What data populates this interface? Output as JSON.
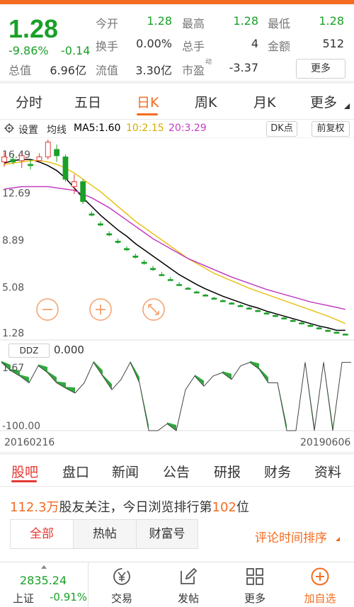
{
  "quote": {
    "price": "1.28",
    "change_pct": "-9.86%",
    "change_abs": "-0.14",
    "fields": [
      {
        "label": "今开",
        "value": "1.28"
      },
      {
        "label": "最高",
        "value": "1.28"
      },
      {
        "label": "最低",
        "value": "1.28"
      },
      {
        "label": "换手",
        "value": "0.00%"
      },
      {
        "label": "总手",
        "value": "4"
      },
      {
        "label": "金额",
        "value": "512"
      },
      {
        "label": "总值",
        "value": "6.96亿"
      },
      {
        "label": "流值",
        "value": "3.30亿"
      },
      {
        "label": "市盈",
        "value": "-3.37"
      }
    ],
    "pe_sup": "动",
    "more_label": "更多"
  },
  "period_tabs": [
    "分时",
    "五日",
    "日K",
    "周K",
    "月K",
    "更多"
  ],
  "active_period": "日K",
  "ma_bar": {
    "settings": "设置",
    "ma_title": "均线",
    "ma5": "MA5:1.60",
    "ma10": "10:2.15",
    "ma20": "20:3.29",
    "dk_label": "DK点",
    "adjust_label": "前复权"
  },
  "colors": {
    "accent": "#f36c21",
    "up": "#e53935",
    "down": "#1aa028",
    "ma5": "#000000",
    "ma10": "#e8c21a",
    "ma20": "#c23ec2"
  },
  "chart_data": [
    {
      "type": "candlestick",
      "title": "",
      "y_ticks": [
        "16.49",
        "12.69",
        "8.89",
        "5.08",
        "1.28"
      ],
      "ylim": [
        1.28,
        16.49
      ],
      "x_start_label": "20160216",
      "x_end_label": "20190606",
      "candles": [
        {
          "o": 15.2,
          "h": 16.0,
          "l": 14.8,
          "c": 15.6
        },
        {
          "o": 15.4,
          "h": 15.8,
          "l": 15.0,
          "c": 15.2
        },
        {
          "o": 15.3,
          "h": 16.0,
          "l": 14.7,
          "c": 15.7
        },
        {
          "o": 15.0,
          "h": 15.4,
          "l": 14.6,
          "c": 14.9
        },
        {
          "o": 15.3,
          "h": 15.9,
          "l": 15.1,
          "c": 15.6
        },
        {
          "o": 15.6,
          "h": 17.0,
          "l": 15.4,
          "c": 16.8
        },
        {
          "o": 16.2,
          "h": 16.6,
          "l": 15.2,
          "c": 15.7
        },
        {
          "o": 15.6,
          "h": 15.8,
          "l": 13.6,
          "c": 13.8
        },
        {
          "o": 13.2,
          "h": 14.2,
          "l": 12.6,
          "c": 13.6
        },
        {
          "o": 13.6,
          "h": 13.8,
          "l": 11.8,
          "c": 12.0
        },
        {
          "o": 11.0,
          "h": 11.2,
          "l": 10.8,
          "c": 10.9
        },
        {
          "o": 10.2,
          "h": 10.4,
          "l": 10.0,
          "c": 10.1
        },
        {
          "o": 9.4,
          "h": 9.6,
          "l": 9.2,
          "c": 9.3
        },
        {
          "o": 8.8,
          "h": 9.0,
          "l": 8.6,
          "c": 8.7
        },
        {
          "o": 8.2,
          "h": 8.4,
          "l": 8.0,
          "c": 8.1
        },
        {
          "o": 7.6,
          "h": 7.8,
          "l": 7.4,
          "c": 7.5
        },
        {
          "o": 7.1,
          "h": 7.3,
          "l": 6.9,
          "c": 7.0
        },
        {
          "o": 6.6,
          "h": 6.8,
          "l": 6.4,
          "c": 6.5
        },
        {
          "o": 6.1,
          "h": 6.3,
          "l": 6.0,
          "c": 6.05
        },
        {
          "o": 5.7,
          "h": 5.9,
          "l": 5.6,
          "c": 5.65
        },
        {
          "o": 5.3,
          "h": 5.5,
          "l": 5.2,
          "c": 5.25
        },
        {
          "o": 5.0,
          "h": 5.1,
          "l": 4.9,
          "c": 4.95
        },
        {
          "o": 4.7,
          "h": 4.8,
          "l": 4.6,
          "c": 4.65
        },
        {
          "o": 4.45,
          "h": 4.55,
          "l": 4.35,
          "c": 4.4
        },
        {
          "o": 4.2,
          "h": 4.3,
          "l": 4.1,
          "c": 4.15
        },
        {
          "o": 4.0,
          "h": 4.1,
          "l": 3.9,
          "c": 3.95
        },
        {
          "o": 3.8,
          "h": 3.9,
          "l": 3.7,
          "c": 3.75
        },
        {
          "o": 3.6,
          "h": 3.7,
          "l": 3.5,
          "c": 3.55
        },
        {
          "o": 3.4,
          "h": 3.5,
          "l": 3.3,
          "c": 3.35
        },
        {
          "o": 3.2,
          "h": 3.3,
          "l": 3.1,
          "c": 3.15
        },
        {
          "o": 3.0,
          "h": 3.1,
          "l": 2.9,
          "c": 2.95
        },
        {
          "o": 2.8,
          "h": 2.9,
          "l": 2.7,
          "c": 2.75
        },
        {
          "o": 2.6,
          "h": 2.7,
          "l": 2.5,
          "c": 2.55
        },
        {
          "o": 2.4,
          "h": 2.5,
          "l": 2.3,
          "c": 2.35
        },
        {
          "o": 2.2,
          "h": 2.3,
          "l": 2.1,
          "c": 2.15
        },
        {
          "o": 2.0,
          "h": 2.1,
          "l": 1.9,
          "c": 1.95
        },
        {
          "o": 1.8,
          "h": 1.9,
          "l": 1.7,
          "c": 1.75
        },
        {
          "o": 1.6,
          "h": 1.7,
          "l": 1.5,
          "c": 1.55
        },
        {
          "o": 1.45,
          "h": 1.5,
          "l": 1.4,
          "c": 1.42
        },
        {
          "o": 1.3,
          "h": 1.35,
          "l": 1.28,
          "c": 1.28
        }
      ],
      "series": [
        {
          "name": "MA5",
          "values": [
            15.1,
            15.3,
            15.4,
            15.4,
            15.2,
            14.9,
            14.5,
            13.9,
            13.1,
            12.3,
            11.6,
            10.9,
            10.3,
            9.7,
            9.2,
            8.6,
            8.1,
            7.6,
            7.1,
            6.6,
            6.1,
            5.7,
            5.3,
            4.95,
            4.65,
            4.35,
            4.1,
            3.85,
            3.6,
            3.4,
            3.15,
            2.95,
            2.75,
            2.55,
            2.35,
            2.15,
            1.95,
            1.8,
            1.6,
            1.6
          ]
        },
        {
          "name": "MA10",
          "values": [
            15.0,
            15.1,
            15.2,
            15.3,
            15.3,
            15.2,
            15.0,
            14.7,
            14.3,
            13.8,
            13.3,
            12.8,
            12.2,
            11.6,
            11.0,
            10.4,
            9.9,
            9.4,
            8.9,
            8.4,
            7.9,
            7.4,
            7.0,
            6.6,
            6.2,
            5.9,
            5.6,
            5.3,
            5.0,
            4.75,
            4.5,
            4.25,
            4.0,
            3.75,
            3.5,
            3.25,
            3.0,
            2.75,
            2.45,
            2.15
          ]
        },
        {
          "name": "MA20",
          "values": [
            13.0,
            13.1,
            13.2,
            13.2,
            13.2,
            13.2,
            13.1,
            13.0,
            12.9,
            12.6,
            12.3,
            11.9,
            11.5,
            11.0,
            10.5,
            10.0,
            9.5,
            9.0,
            8.6,
            8.2,
            7.8,
            7.4,
            7.1,
            6.8,
            6.5,
            6.2,
            5.9,
            5.65,
            5.4,
            5.15,
            4.9,
            4.7,
            4.5,
            4.3,
            4.1,
            3.9,
            3.75,
            3.6,
            3.45,
            3.29
          ]
        }
      ]
    },
    {
      "type": "area",
      "title": "",
      "name": "DDZ",
      "current_value": "0.000",
      "y_ticks": [
        "1.67",
        "-100.00"
      ],
      "ylim": [
        -100,
        1.67
      ],
      "values": [
        0,
        -12,
        -20,
        -30,
        -5,
        -15,
        -30,
        -38,
        -45,
        -30,
        0,
        -20,
        -40,
        -25,
        0,
        -30,
        -100,
        -100,
        -90,
        -100,
        -40,
        -20,
        -35,
        -20,
        -15,
        -25,
        -5,
        0,
        -10,
        -30,
        -30,
        -100,
        -100,
        0,
        -100,
        0,
        -100,
        0,
        0
      ]
    }
  ],
  "content_tabs": [
    "股吧",
    "盘口",
    "新闻",
    "公告",
    "研报",
    "财务",
    "资料"
  ],
  "active_content_tab": "股吧",
  "forum": {
    "followers_num": "112.3万",
    "followers_text": "股友关注，今日浏览排行第",
    "rank": "102",
    "rank_suffix": "位",
    "filters": [
      "全部",
      "热帖",
      "财富号"
    ],
    "sort_label": "评论时间排序"
  },
  "bottom_nav": {
    "index_value": "2835.24",
    "index_name": "上证",
    "index_change": "-0.91%",
    "items": [
      {
        "label": "交易",
        "icon": "yen-circle-icon"
      },
      {
        "label": "发帖",
        "icon": "edit-icon"
      },
      {
        "label": "更多",
        "icon": "grid-icon"
      },
      {
        "label": "加自选",
        "icon": "plus-circle-icon"
      }
    ]
  }
}
